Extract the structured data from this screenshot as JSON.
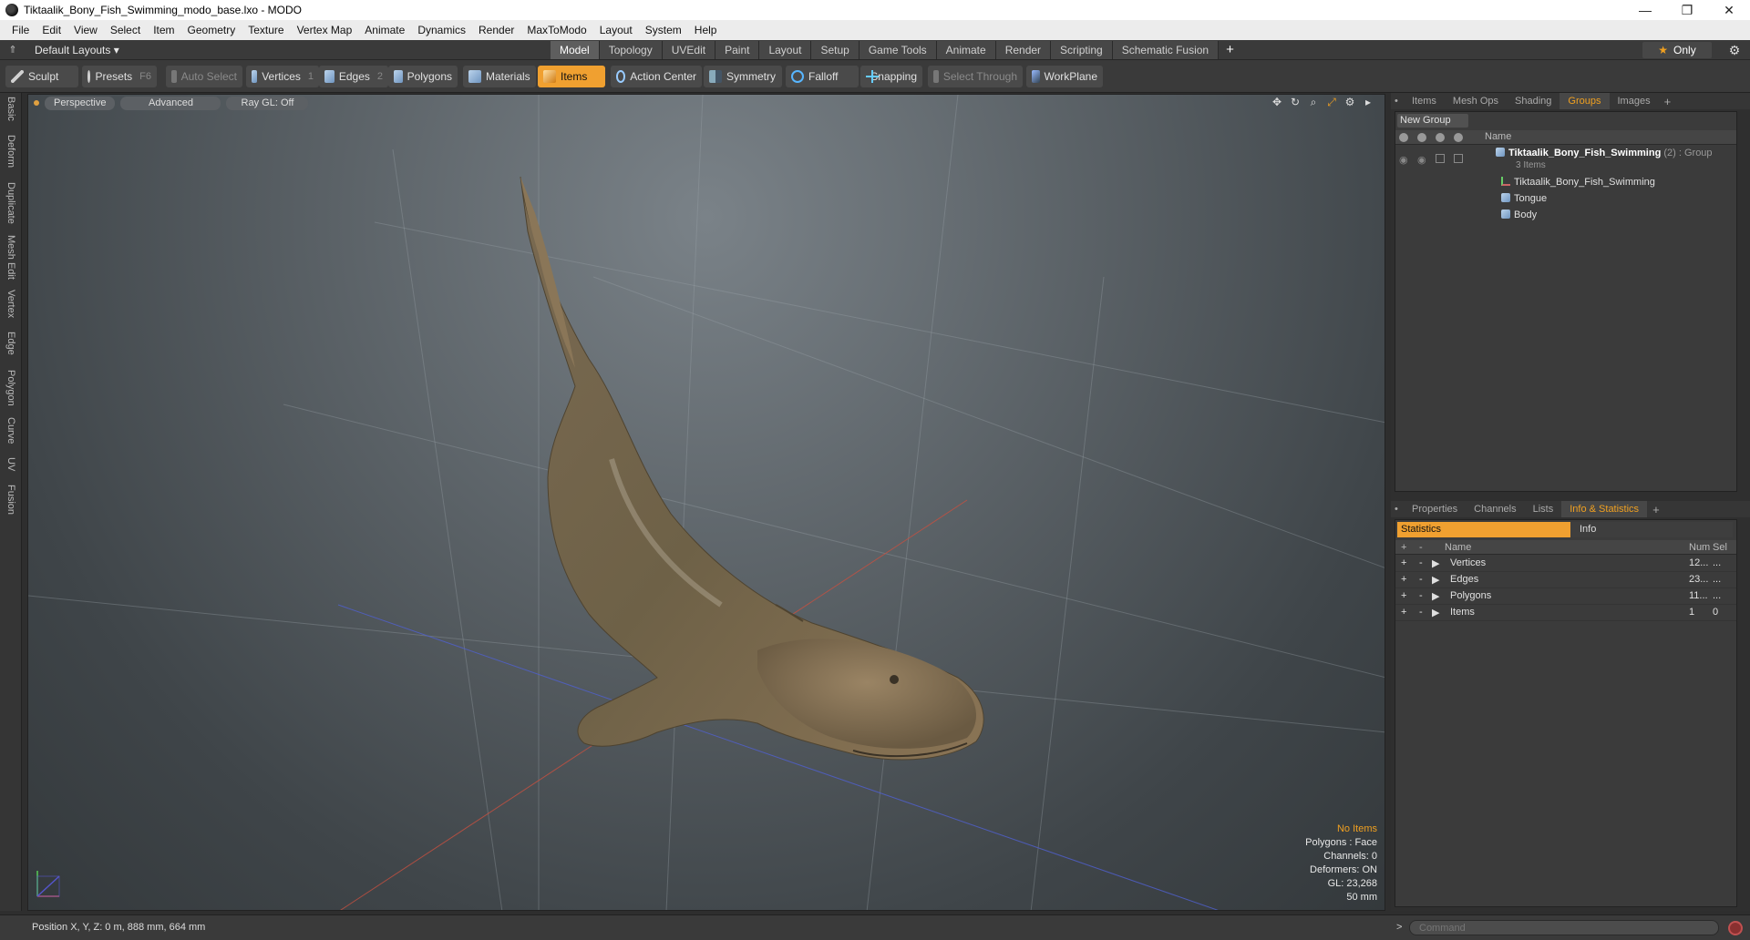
{
  "window": {
    "title": "Tiktaalik_Bony_Fish_Swimming_modo_base.lxo - MODO",
    "minimize": "—",
    "maximize": "❐",
    "close": "✕"
  },
  "menu": [
    "File",
    "Edit",
    "View",
    "Select",
    "Item",
    "Geometry",
    "Texture",
    "Vertex Map",
    "Animate",
    "Dynamics",
    "Render",
    "MaxToModo",
    "Layout",
    "System",
    "Help"
  ],
  "layoutbar": {
    "layout_select": "Default Layouts ▾",
    "tabs": [
      "Model",
      "Topology",
      "UVEdit",
      "Paint",
      "Layout",
      "Setup",
      "Game Tools",
      "Animate",
      "Render",
      "Scripting",
      "Schematic Fusion"
    ],
    "active_tab": "Model",
    "add": "+",
    "only_label": "Only"
  },
  "toolbar": {
    "sculpt": "Sculpt",
    "presets": "Presets",
    "presets_key": "F6",
    "auto_select": "Auto Select",
    "vertices": "Vertices",
    "vertices_key": "1",
    "edges": "Edges",
    "edges_key": "2",
    "polygons": "Polygons",
    "materials": "Materials",
    "items": "Items",
    "action_center": "Action Center",
    "symmetry": "Symmetry",
    "falloff": "Falloff",
    "snapping": "Snapping",
    "select_through": "Select Through",
    "workplane": "WorkPlane"
  },
  "lefttabs": [
    "Basic",
    "Deform",
    "Duplicate",
    "Mesh Edit",
    "Vertex",
    "Edge",
    "Polygon",
    "Curve",
    "UV",
    "Fusion"
  ],
  "viewport": {
    "perspective": "Perspective",
    "advanced": "Advanced",
    "raygl": "Ray GL: Off",
    "info": {
      "no_items": "No Items",
      "polygons": "Polygons : Face",
      "channels": "Channels: 0",
      "deformers": "Deformers: ON",
      "gl": "GL: 23,268",
      "size": "50 mm"
    }
  },
  "upper_tabs": [
    "Items",
    "Mesh Ops",
    "Shading",
    "Groups",
    "Images"
  ],
  "upper_active": "Groups",
  "groups": {
    "new_group": "New Group",
    "name_header": "Name",
    "root_name": "Tiktaalik_Bony_Fish_Swimming",
    "root_suffix": "(2) : Group",
    "root_count": "3 Items",
    "children": [
      "Tiktaalik_Bony_Fish_Swimming",
      "Tongue",
      "Body"
    ]
  },
  "lower_tabs": [
    "Properties",
    "Channels",
    "Lists",
    "Info & Statistics"
  ],
  "lower_active": "Info & Statistics",
  "stats": {
    "tab_statistics": "Statistics",
    "tab_info": "Info",
    "headers": {
      "plus": "+",
      "minus": "-",
      "name": "Name",
      "num": "Num",
      "sel": "Sel"
    },
    "rows": [
      {
        "name": "Vertices",
        "num": "12...",
        "sel": "..."
      },
      {
        "name": "Edges",
        "num": "23...",
        "sel": "..."
      },
      {
        "name": "Polygons",
        "num": "11...",
        "sel": "..."
      },
      {
        "name": "Items",
        "num": "1",
        "sel": "0"
      }
    ]
  },
  "statusbar": {
    "position": "Position X, Y, Z:   0 m, 888 mm, 664 mm"
  },
  "command": {
    "prompt": ">",
    "placeholder": "Command"
  },
  "colors": {
    "accent": "#f0a030",
    "viewport_top": "#7a8288",
    "viewport_bottom": "#34393c"
  }
}
